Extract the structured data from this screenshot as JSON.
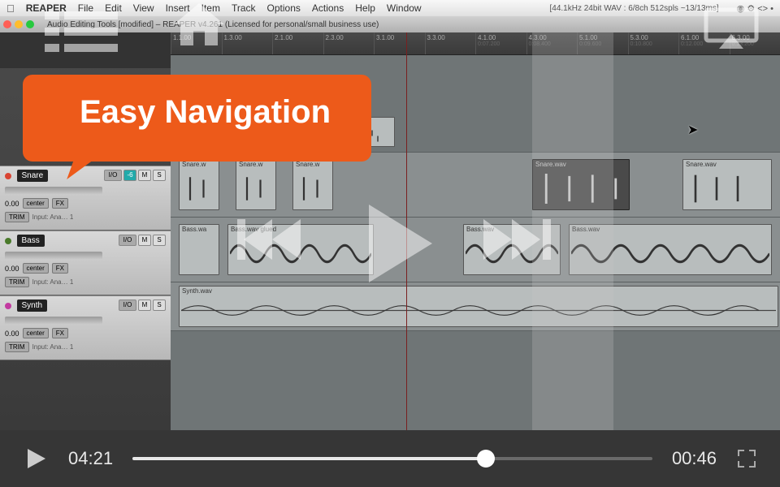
{
  "menubar": {
    "app": "REAPER",
    "items": [
      "File",
      "Edit",
      "View",
      "Insert",
      "Item",
      "Track",
      "Options",
      "Actions",
      "Help",
      "Window"
    ],
    "status": "[44.1kHz 24bit WAV : 6/8ch 512spls ~13/13ms]"
  },
  "window": {
    "title": "Audio Editing Tools [modified] – REAPER v4.261 (Licensed for personal/small business use)"
  },
  "ruler": [
    {
      "bar": "1.1.00",
      "time": ""
    },
    {
      "bar": "1.3.00",
      "time": ""
    },
    {
      "bar": "2.1.00",
      "time": ""
    },
    {
      "bar": "2.3.00",
      "time": ""
    },
    {
      "bar": "3.1.00",
      "time": ""
    },
    {
      "bar": "3.3.00",
      "time": ""
    },
    {
      "bar": "4.1.00",
      "time": "0:07.200"
    },
    {
      "bar": "4.3.00",
      "time": "0:08.400"
    },
    {
      "bar": "5.1.00",
      "time": "0:09.600"
    },
    {
      "bar": "5.3.00",
      "time": "0:10.800"
    },
    {
      "bar": "6.1.00",
      "time": "0:12.000"
    },
    {
      "bar": "6.3.00",
      "time": "0:13.200"
    }
  ],
  "tracks": [
    {
      "name": "Snare",
      "color": "#d94433",
      "io": "I/O",
      "pan": "center",
      "vol": "0.00",
      "btns": {
        "m": "M",
        "s": "S"
      },
      "route": "-6",
      "fx": "FX",
      "trim": "TRIM",
      "input": "Input: Ana… 1"
    },
    {
      "name": "Bass",
      "color": "#4a7a2a",
      "io": "I/O",
      "pan": "center",
      "vol": "0.00",
      "btns": {
        "m": "M",
        "s": "S"
      },
      "fx": "FX",
      "trim": "TRIM",
      "input": "Input: Ana… 1"
    },
    {
      "name": "Synth",
      "color": "#c23aa0",
      "io": "I/O",
      "pan": "center",
      "vol": "0.00",
      "btns": {
        "m": "M",
        "s": "S"
      },
      "fx": "FX",
      "trim": "TRIM",
      "input": "Input: Ana… 1"
    }
  ],
  "clips": {
    "snare": [
      {
        "label": "Snare.w"
      },
      {
        "label": "Snare.w"
      },
      {
        "label": "Snare.w"
      },
      {
        "label": "Snare.wav"
      },
      {
        "label": "Snare.wav"
      }
    ],
    "bass": [
      {
        "label": "Bass.wa"
      },
      {
        "label": "Bass.wav glued"
      },
      {
        "label": "Bass.wav"
      },
      {
        "label": "Bass.wav"
      }
    ],
    "synth": [
      {
        "label": "Synth.wav"
      }
    ]
  },
  "callout": "Easy Navigation",
  "player": {
    "elapsed": "04:21",
    "remaining": "00:46"
  }
}
